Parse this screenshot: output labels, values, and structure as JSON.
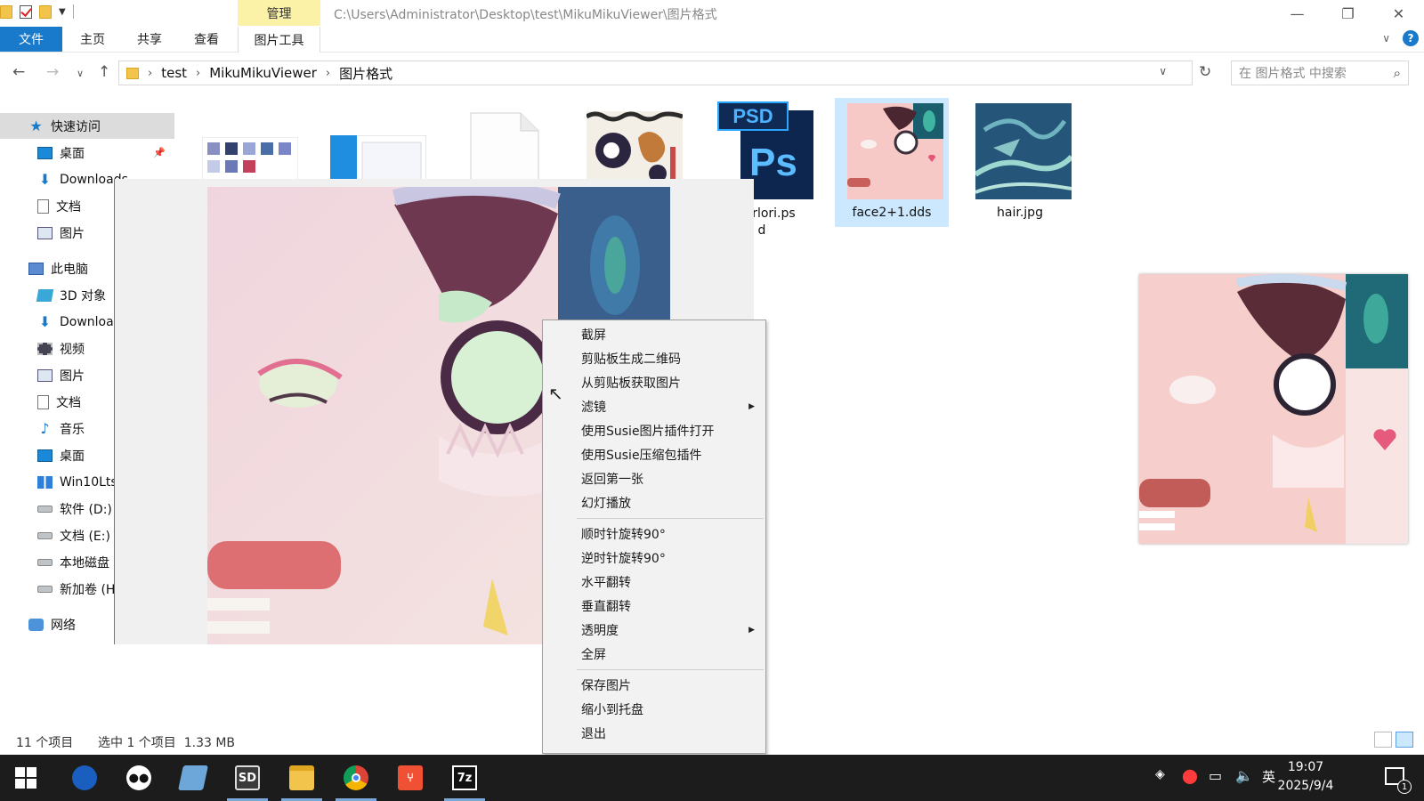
{
  "window": {
    "title_path": "C:\\Users\\Administrator\\Desktop\\test\\MikuMikuViewer\\图片格式",
    "manage_tab": "管理"
  },
  "ribbon": {
    "tabs": [
      {
        "label": "文件"
      },
      {
        "label": "主页"
      },
      {
        "label": "共享"
      },
      {
        "label": "查看"
      },
      {
        "label": "图片工具"
      }
    ],
    "help": "?"
  },
  "address": {
    "crumbs": [
      "test",
      "MikuMikuViewer",
      "图片格式"
    ],
    "search_placeholder": "在 图片格式 中搜索"
  },
  "sidebar": {
    "items": [
      {
        "label": "快速访问",
        "icon": "star-icon"
      },
      {
        "label": "桌面",
        "icon": "desktop-icon"
      },
      {
        "label": "Downloads",
        "icon": "download-icon"
      },
      {
        "label": "文档",
        "icon": "document-icon"
      },
      {
        "label": "图片",
        "icon": "picture-icon"
      },
      {
        "label": "此电脑",
        "icon": "computer-icon"
      },
      {
        "label": "3D 对象",
        "icon": "cube-icon"
      },
      {
        "label": "Downloa",
        "icon": "download-icon"
      },
      {
        "label": "视频",
        "icon": "video-icon"
      },
      {
        "label": "图片",
        "icon": "picture-icon"
      },
      {
        "label": "文档",
        "icon": "document-icon"
      },
      {
        "label": "音乐",
        "icon": "music-icon"
      },
      {
        "label": "桌面",
        "icon": "desktop-icon"
      },
      {
        "label": "Win10Lts",
        "icon": "windows-drive-icon"
      },
      {
        "label": "软件 (D:)",
        "icon": "drive-icon"
      },
      {
        "label": "文档 (E:)",
        "icon": "drive-icon"
      },
      {
        "label": "本地磁盘",
        "icon": "drive-icon"
      },
      {
        "label": "新加卷 (H",
        "icon": "drive-icon"
      },
      {
        "label": "网络",
        "icon": "network-icon"
      }
    ]
  },
  "files": [
    {
      "label": "ergirlori.ps\nd",
      "type": "psd"
    },
    {
      "label": "face2+1.dds",
      "type": "image"
    },
    {
      "label": "hair.jpg",
      "type": "image"
    }
  ],
  "psd_icon": {
    "tag": "PSD",
    "glyph": "Ps"
  },
  "context_menu": {
    "items": [
      {
        "label": "截屏"
      },
      {
        "label": "剪贴板生成二维码"
      },
      {
        "label": "从剪贴板获取图片"
      },
      {
        "label": "滤镜",
        "submenu": true
      },
      {
        "label": "使用Susie图片插件打开"
      },
      {
        "label": "使用Susie压缩包插件"
      },
      {
        "label": "返回第一张"
      },
      {
        "label": "幻灯播放"
      },
      {
        "label": "顺时针旋转90°"
      },
      {
        "label": "逆时针旋转90°"
      },
      {
        "label": "水平翻转"
      },
      {
        "label": "垂直翻转"
      },
      {
        "label": "透明度",
        "submenu": true
      },
      {
        "label": "全屏"
      },
      {
        "label": "保存图片"
      },
      {
        "label": "缩小到托盘"
      },
      {
        "label": "退出"
      }
    ]
  },
  "status": {
    "count": "11 个项目",
    "selection": "选中 1 个项目  1.33 MB"
  },
  "taskbar": {
    "apps": [
      {
        "icon": "start-icon"
      },
      {
        "icon": "browser-icon"
      },
      {
        "icon": "panda-icon"
      },
      {
        "icon": "book-icon"
      },
      {
        "icon": "sd-icon",
        "text": "SD"
      },
      {
        "icon": "file-explorer-icon"
      },
      {
        "icon": "chrome-icon"
      },
      {
        "icon": "git-icon"
      },
      {
        "icon": "7zip-icon",
        "text": "7z"
      }
    ],
    "ime": "英",
    "time": "19:07",
    "date": "2025/9/4",
    "notification_count": "1"
  },
  "colors": {
    "accent": "#1979ca",
    "manage_tab": "#fbf2a8",
    "selection": "#cce8ff",
    "taskbar": "#1c1c1c"
  }
}
